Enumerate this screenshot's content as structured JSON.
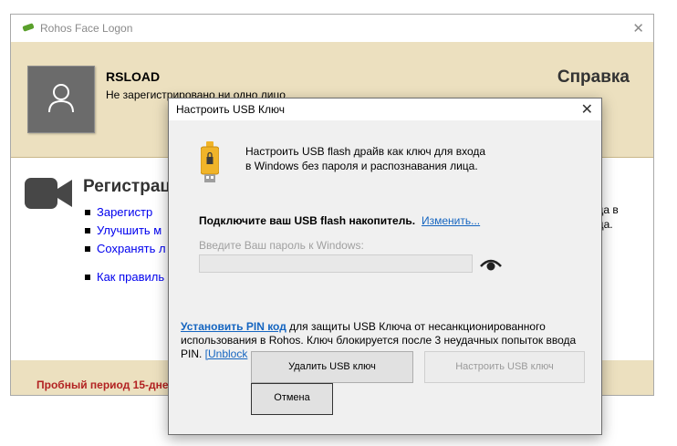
{
  "main_window": {
    "title": "Rohos Face Logon",
    "close_label": "✕"
  },
  "header": {
    "user_name": "RSLOAD",
    "status": "Не зарегистрировано ни одно лицо",
    "help_title": "Справка"
  },
  "registration": {
    "title": "Регистрац",
    "items": [
      {
        "label": "Зарегистр"
      },
      {
        "label": "Улучшить м"
      },
      {
        "label": "Сохранять л"
      },
      {
        "label": "Как правиль"
      }
    ],
    "right_text_line1": "ода в",
    "right_text_line2": "ица."
  },
  "footer": {
    "trial_text": "Пробный период 15-дне"
  },
  "dialog": {
    "title": "Настроить USB Ключ",
    "close_label": "✕",
    "intro_line1": "Настроить USB flash драйв как ключ для входа",
    "intro_line2": "в Windows без пароля и распознавания лица.",
    "connect_label": "Подключите ваш USB flash накопитель.",
    "change_link": "Изменить...",
    "password_label": "Введите Ваш пароль к Windows:",
    "password_value": "",
    "pin_link": "Установить PIN код",
    "pin_text_rest": " для защиты USB Ключа от несанкционированного использования в Rohos. Ключ блокируется после 3 неудачных попыток ввода PIN. ",
    "unblock_link": "[Unblock",
    "delete_button": "Удалить USB ключ",
    "config_button": "Настроить USB ключ",
    "cancel_button": "Отмена"
  },
  "colors": {
    "header_bg": "#ece0bf",
    "link": "#1565c0",
    "trial_red": "#b22222",
    "usb_yellow": "#f0b429"
  }
}
